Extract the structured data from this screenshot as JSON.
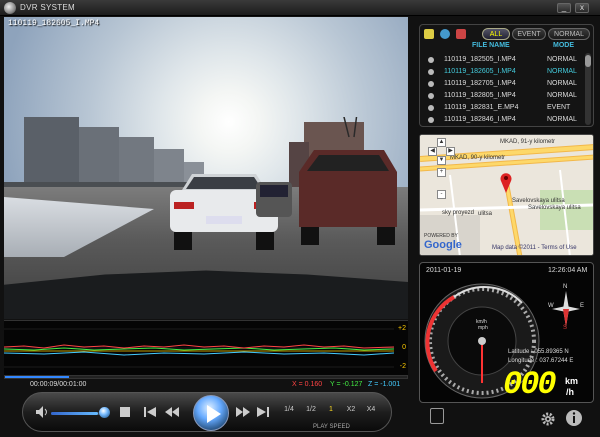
{
  "window": {
    "title": "DVR SYSTEM",
    "minimize_label": "_",
    "close_label": "x"
  },
  "video": {
    "filename_overlay": "110119_182605_I.MP4"
  },
  "graph": {
    "tick_top": "+2",
    "tick_mid": "0",
    "tick_bottom": "-2"
  },
  "playback": {
    "time": "00:00:09/00:01:00",
    "progress_fraction": 0.16,
    "volume_fraction": 0.9,
    "g_x": "X = 0.160",
    "g_y": "Y = -0.127",
    "g_z": "Z = -1.001",
    "speeds": [
      "1/4",
      "1/2",
      "1",
      "X2",
      "X4"
    ],
    "active_speed": "1",
    "play_speed_label": "PLAY SPEED"
  },
  "filelist": {
    "tabs": [
      "ALL",
      "EVENT",
      "NORMAL"
    ],
    "active_tab": "ALL",
    "col_name": "FILE NAME",
    "col_mode": "MODE",
    "rows": [
      {
        "name": "110119_182505_I.MP4",
        "mode": "NORMAL",
        "selected": false
      },
      {
        "name": "110119_182605_I.MP4",
        "mode": "NORMAL",
        "selected": true
      },
      {
        "name": "110119_182705_I.MP4",
        "mode": "NORMAL",
        "selected": false
      },
      {
        "name": "110119_182805_I.MP4",
        "mode": "NORMAL",
        "selected": false
      },
      {
        "name": "110119_182831_E.MP4",
        "mode": "EVENT",
        "selected": false
      },
      {
        "name": "110119_182846_I.MP4",
        "mode": "NORMAL",
        "selected": false
      }
    ]
  },
  "map": {
    "road_label_1": "MKAD, 91-y kilometr",
    "road_label_2": "MKAD, 90-y kilometr",
    "street_label_1": "Savelovskaya ulitsa",
    "street_label_2": "Savelovskaya ulitsa",
    "street_label_3": "ulitsa",
    "street_label_4": "sky proyezd",
    "powered_by": "POWERED BY",
    "google": "Google",
    "attribution": "Map data ©2011 - Terms of Use"
  },
  "gauge": {
    "date": "2011-01-19",
    "time": "12:26:04 AM",
    "compass_n": "N",
    "compass_s": "S",
    "compass_e": "E",
    "compass_w": "W",
    "speed_unit_small": "km/h",
    "speed_unit_small2": "mph",
    "latitude": "Latitude : 055.89365 N",
    "longitude": "Longitude : 037.67244 E",
    "speed": "000",
    "unit_km": "km",
    "unit_h": "/h"
  },
  "colors": {
    "accent_blue": "#3388ff",
    "speed_yellow": "#ffee00",
    "graph_x": "#ff4444",
    "graph_y": "#44ee44",
    "graph_z": "#44ccff"
  }
}
